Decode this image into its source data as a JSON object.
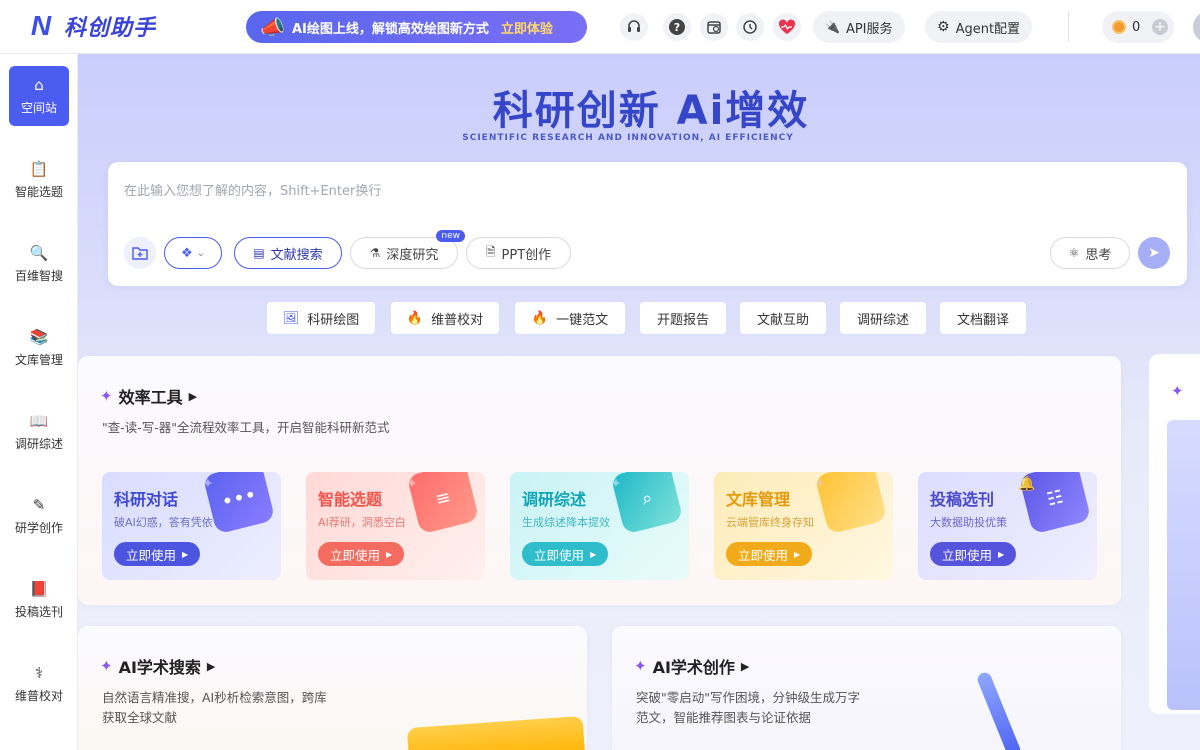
{
  "header": {
    "logo_text": "科创助手",
    "promo_text": "AI绘图上线，解锁高效绘图新方式",
    "promo_cta": "立即体验",
    "api_label": "API服务",
    "agent_label": "Agent配置",
    "coins": "0"
  },
  "sidebar": {
    "items": [
      {
        "label": "空间站"
      },
      {
        "label": "智能选题"
      },
      {
        "label": "百维智搜"
      },
      {
        "label": "文库管理"
      },
      {
        "label": "调研综述"
      },
      {
        "label": "研学创作"
      },
      {
        "label": "投稿选刊"
      },
      {
        "label": "维普校对"
      }
    ]
  },
  "hero": {
    "title": "科研创新 Ai增效",
    "subtitle": "SCIENTIFIC RESEARCH AND INNOVATION, AI EFFICIENCY"
  },
  "search": {
    "placeholder": "在此输入您想了解的内容，Shift+Enter换行",
    "modes": [
      {
        "label": "文献搜索"
      },
      {
        "label": "深度研究",
        "badge": "new"
      },
      {
        "label": "PPT创作"
      }
    ],
    "think_label": "思考"
  },
  "quick_actions": [
    {
      "label": "科研绘图"
    },
    {
      "label": "维普校对"
    },
    {
      "label": "一键范文"
    },
    {
      "label": "开题报告"
    },
    {
      "label": "文献互助"
    },
    {
      "label": "调研综述"
    },
    {
      "label": "文档翻译"
    }
  ],
  "efficiency": {
    "title": "效率工具",
    "desc": "\"查-读-写-器\"全流程效率工具，开启智能科研新范式",
    "cards": [
      {
        "title": "科研对话",
        "sub": "破AI幻惑，答有凭依",
        "cta": "立即使用",
        "color": "#3f4ad6"
      },
      {
        "title": "智能选题",
        "sub": "AI荐研，洞悉空白",
        "cta": "立即使用",
        "color": "#f0544b"
      },
      {
        "title": "调研综述",
        "sub": "生成综述降本提效",
        "cta": "立即使用",
        "color": "#13a6b8"
      },
      {
        "title": "文库管理",
        "sub": "云端管库终身存知",
        "cta": "立即使用",
        "color": "#e59a0c"
      },
      {
        "title": "投稿选刊",
        "sub": "大数据助投优策",
        "cta": "立即使用",
        "color": "#4a48cc"
      }
    ]
  },
  "ai_search": {
    "title": "AI学术搜索",
    "desc1": "自然语言精准搜，AI秒析检索意图，跨库",
    "desc2": "获取全球文献"
  },
  "ai_writing": {
    "title": "AI学术创作",
    "desc1": "突破\"零启动\"写作困境，分钟级生成万字",
    "desc2": "范文，智能推荐图表与论证依据"
  }
}
